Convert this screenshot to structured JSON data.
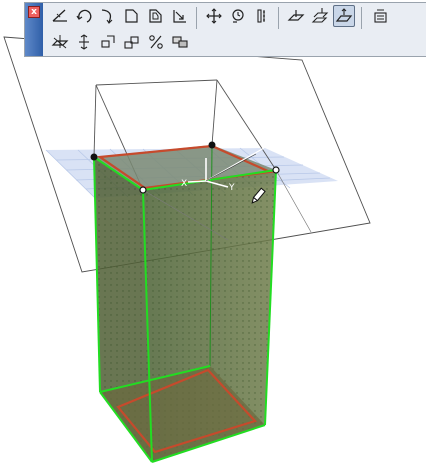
{
  "palette": {
    "close_glyph": "x",
    "row1_tools": [
      "element-cutting-icon",
      "rotate-icon",
      "curve-arc-icon",
      "offset-icon",
      "offset-all-icon",
      "resize-icon",
      "drag-icon",
      "rotate-view-icon",
      "elevate-icon",
      "plane-icon",
      "multi-plane-icon",
      "active-plane-icon",
      "calculator-icon"
    ],
    "row2_tools": [
      "move-plane-icon",
      "split-icon",
      "merge-icon",
      "duplicate-icon",
      "percent-icon",
      "layer-icon"
    ],
    "active_tool": "active-plane-icon"
  },
  "model": {
    "axis_labels": {
      "x": "X",
      "y": "Y"
    },
    "colors": {
      "edge": "#22cc22",
      "body": "#4a6a2e",
      "plane_grid": "#c9d9f2",
      "trace": "#c64a2c",
      "frame": "#666666"
    }
  }
}
